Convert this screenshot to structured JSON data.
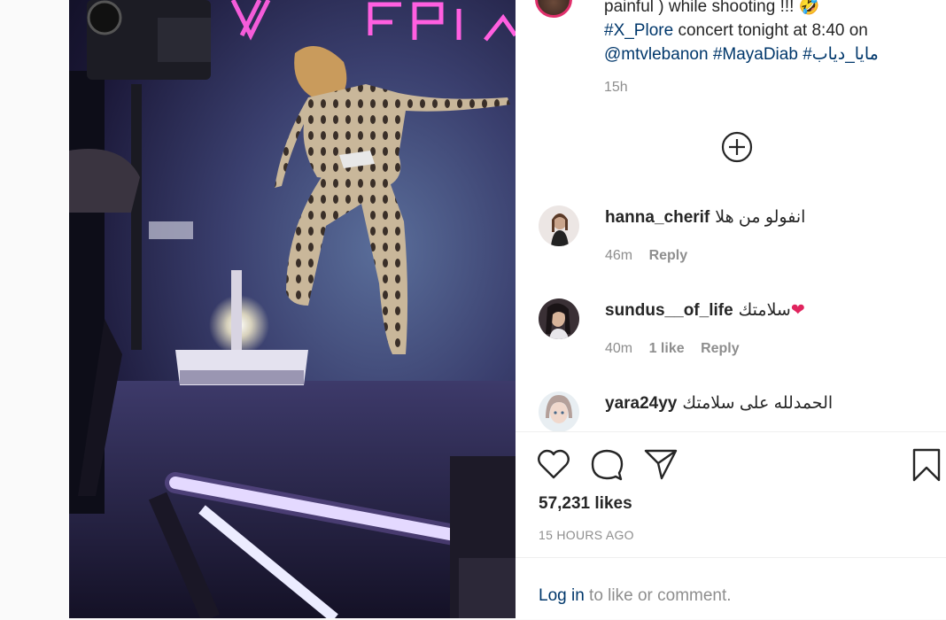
{
  "caption": {
    "line1": "painful ) while shooting !!! 🤣",
    "line2_tag": "#X_Plore",
    "line2_text": " concert tonight at 8:40 on",
    "mention": "@mtvlebanon",
    "tag2": "#MayaDiab",
    "tag3": "#مايا_دياب",
    "time": "15h"
  },
  "load_more_icon": "plus-circle-icon",
  "comments": [
    {
      "user": "hanna_cherif",
      "text": "انفولو من هلا",
      "time": "46m",
      "likes": "",
      "reply": "Reply"
    },
    {
      "user": "sundus__of_life",
      "text": "سلامتك",
      "emoji": "❤",
      "time": "40m",
      "likes": "1 like",
      "reply": "Reply"
    },
    {
      "user": "yara24yy",
      "text": "الحمدلله على سلامتك",
      "time": "",
      "likes": "",
      "reply": ""
    }
  ],
  "actions": {
    "like_icon": "heart-icon",
    "comment_icon": "comment-icon",
    "share_icon": "paper-plane-icon",
    "save_icon": "bookmark-icon"
  },
  "likes": "57,231 likes",
  "posted": "15 HOURS AGO",
  "login": {
    "link": "Log in",
    "text": " to like or comment."
  },
  "colors": {
    "link": "#00376b",
    "muted": "#8e8e8e",
    "text": "#262626",
    "neon": "#ff3fd0"
  }
}
